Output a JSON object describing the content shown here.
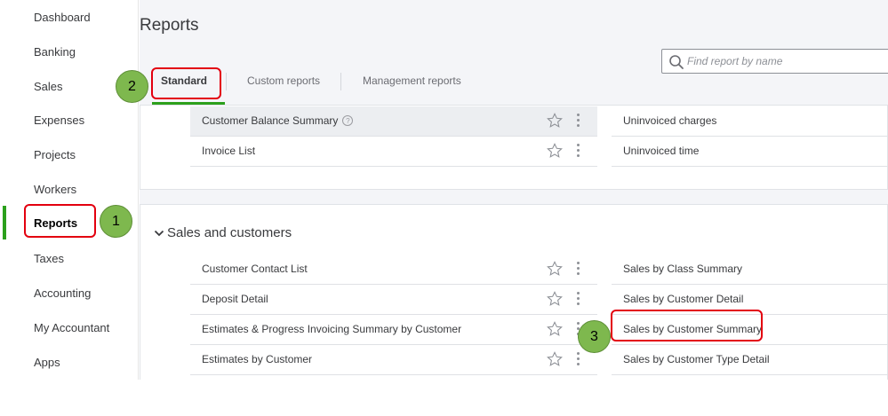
{
  "sidebar": {
    "items": [
      {
        "label": "Dashboard"
      },
      {
        "label": "Banking"
      },
      {
        "label": "Sales"
      },
      {
        "label": "Expenses"
      },
      {
        "label": "Projects"
      },
      {
        "label": "Workers"
      },
      {
        "label": "Reports"
      },
      {
        "label": "Taxes"
      },
      {
        "label": "Accounting"
      },
      {
        "label": "My Accountant"
      },
      {
        "label": "Apps"
      }
    ],
    "active": "Reports"
  },
  "page": {
    "title": "Reports"
  },
  "search": {
    "placeholder": "Find report by name"
  },
  "tabs": [
    {
      "label": "Standard"
    },
    {
      "label": "Custom reports"
    },
    {
      "label": "Management reports"
    }
  ],
  "top_section": {
    "left_rows": [
      {
        "label": "Customer Balance Summary",
        "help": "?"
      },
      {
        "label": "Invoice List"
      }
    ],
    "right_rows": [
      {
        "label": "Uninvoiced charges"
      },
      {
        "label": "Uninvoiced time"
      }
    ]
  },
  "sales_section": {
    "title": "Sales and customers",
    "left_rows": [
      {
        "label": "Customer Contact List"
      },
      {
        "label": "Deposit Detail"
      },
      {
        "label": "Estimates & Progress Invoicing Summary by Customer"
      },
      {
        "label": "Estimates by Customer"
      }
    ],
    "right_rows": [
      {
        "label": "Sales by Class Summary"
      },
      {
        "label": "Sales by Customer Detail"
      },
      {
        "label": "Sales by Customer Summary"
      },
      {
        "label": "Sales by Customer Type Detail"
      }
    ]
  },
  "annotations": [
    {
      "number": "1"
    },
    {
      "number": "2"
    },
    {
      "number": "3"
    }
  ],
  "colors": {
    "accent": "#2ca01c",
    "callout": "#e3000f",
    "badge": "#7eb84e"
  }
}
